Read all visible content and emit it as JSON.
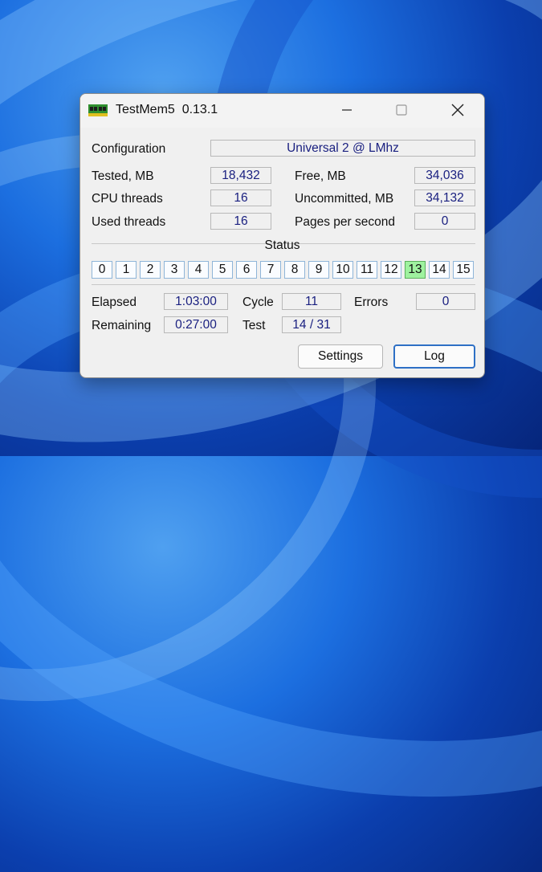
{
  "window": {
    "title": "TestMem5  0.13.1",
    "icon": "memory-module-icon"
  },
  "config": {
    "label": "Configuration",
    "value": "Universal 2 @ LMhz"
  },
  "stats": {
    "tested": {
      "label": "Tested, MB",
      "value": "18,432"
    },
    "free": {
      "label": "Free, MB",
      "value": "34,036"
    },
    "cpu_threads": {
      "label": "CPU threads",
      "value": "16"
    },
    "uncommitted": {
      "label": "Uncommitted, MB",
      "value": "34,132"
    },
    "used_threads": {
      "label": "Used threads",
      "value": "16"
    },
    "pages_per_second": {
      "label": "Pages per second",
      "value": "0"
    }
  },
  "status": {
    "title": "Status",
    "tiles": [
      "0",
      "1",
      "2",
      "3",
      "4",
      "5",
      "6",
      "7",
      "8",
      "9",
      "10",
      "11",
      "12",
      "13",
      "14",
      "15"
    ],
    "active_index": 13,
    "active_color": "#9ff29f"
  },
  "timing": {
    "elapsed": {
      "label": "Elapsed",
      "value": "1:03:00"
    },
    "cycle": {
      "label": "Cycle",
      "value": "11"
    },
    "errors": {
      "label": "Errors",
      "value": "0"
    },
    "remaining": {
      "label": "Remaining",
      "value": "0:27:00"
    },
    "test": {
      "label": "Test",
      "value": "14 / 31"
    }
  },
  "buttons": {
    "settings": "Settings",
    "log": "Log"
  }
}
